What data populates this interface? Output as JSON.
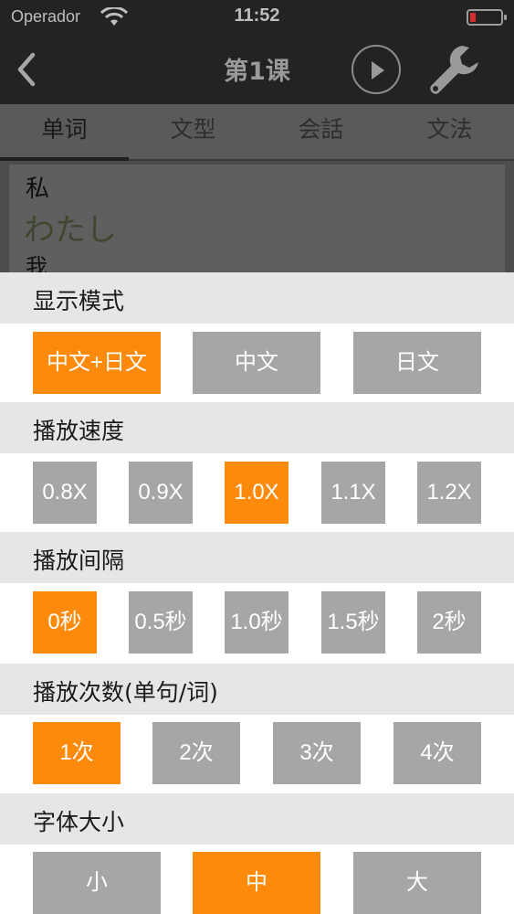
{
  "status": {
    "carrier": "Operador",
    "time": "11:52"
  },
  "nav": {
    "title": "第1课",
    "back_icon": "chevron-left-icon",
    "play_icon": "play-icon",
    "settings_icon": "wrench-icon"
  },
  "tabs": [
    {
      "label": "单词",
      "active": true
    },
    {
      "label": "文型",
      "active": false
    },
    {
      "label": "会話",
      "active": false
    },
    {
      "label": "文法",
      "active": false
    }
  ],
  "word": {
    "kanji": "私",
    "kana": "わたし",
    "meaning": "我"
  },
  "settings": {
    "display_mode": {
      "title": "显示模式",
      "options": [
        "中文+日文",
        "中文",
        "日文"
      ],
      "selected": "中文+日文"
    },
    "speed": {
      "title": "播放速度",
      "options": [
        "0.8X",
        "0.9X",
        "1.0X",
        "1.1X",
        "1.2X"
      ],
      "selected": "1.0X"
    },
    "interval": {
      "title": "播放间隔",
      "options": [
        "0秒",
        "0.5秒",
        "1.0秒",
        "1.5秒",
        "2秒"
      ],
      "selected": "0秒"
    },
    "repeat": {
      "title": "播放次数(单句/词)",
      "options": [
        "1次",
        "2次",
        "3次",
        "4次"
      ],
      "selected": "1次"
    },
    "font_size": {
      "title": "字体大小",
      "options": [
        "小",
        "中",
        "大"
      ],
      "selected": "中"
    }
  },
  "colors": {
    "accent": "#fe8a0b",
    "option_off": "#a6a6a6",
    "section_bg": "#e6e6e6"
  }
}
